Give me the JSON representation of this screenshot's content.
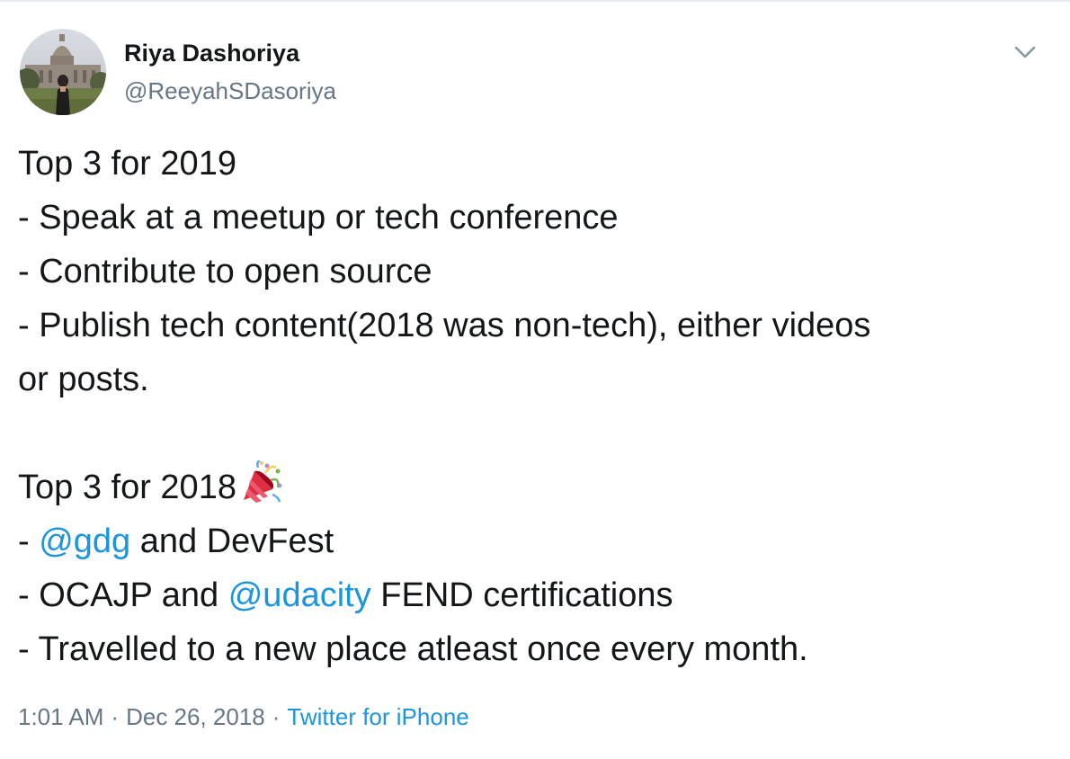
{
  "author": {
    "name": "Riya Dashoriya",
    "handle": "@ReeyahSDasoriya",
    "avatar_icon": "profile-photo-capitol-building"
  },
  "menu": {
    "icon": "chevron-down-icon"
  },
  "tweet": {
    "lines": [
      {
        "pre": "Top 3 for 2019"
      },
      {
        "pre": "- Speak at a meetup or tech conference"
      },
      {
        "pre": "- Contribute to open source"
      },
      {
        "pre": "- Publish tech content(2018 was non-tech), either videos"
      },
      {
        "pre": "or posts."
      },
      {
        "pre": ""
      },
      {
        "pre": "Top 3 for 2018",
        "emoji": "party-popper-icon"
      },
      {
        "pre": "- ",
        "mention": "@gdg",
        "post": " and DevFest"
      },
      {
        "pre": "- OCAJP and ",
        "mention": "@udacity",
        "post": " FEND certifications"
      },
      {
        "pre": "- Travelled to a new place atleast once every month."
      }
    ]
  },
  "meta": {
    "time": "1:01 AM",
    "separator": "·",
    "date": "Dec 26, 2018",
    "source": "Twitter for iPhone"
  },
  "colors": {
    "link": "#1b95e0",
    "secondary_text": "#657786",
    "primary_text": "#14171a"
  }
}
